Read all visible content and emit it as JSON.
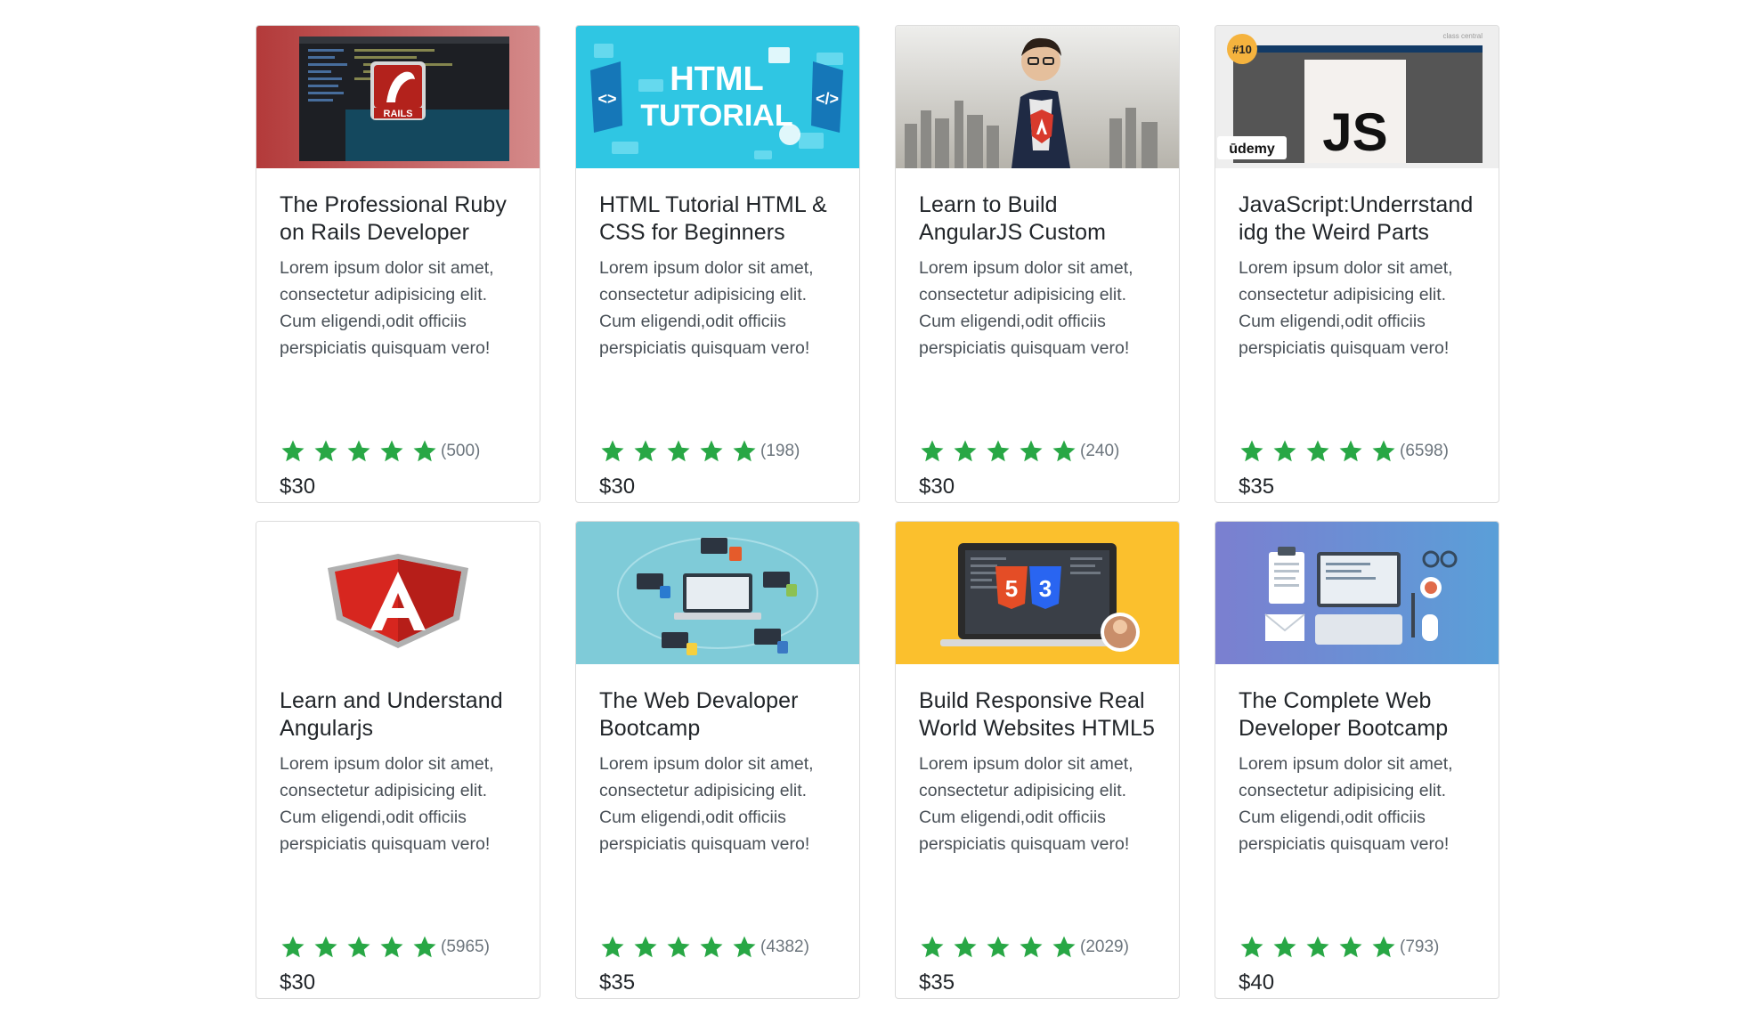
{
  "colors": {
    "star": "#28a745",
    "border": "#dcdcdc",
    "text": "#212529",
    "muted": "#6c757d"
  },
  "courses": [
    {
      "thumb": "rails",
      "thumb_text": [
        "RAILS"
      ],
      "title": "The Professional Ruby on Rails Developer",
      "description": "Lorem ipsum dolor sit amet, consectetur adipisicing elit. Cum eligendi,odit officiis perspiciatis quisquam vero!",
      "stars": 5,
      "count": "(500)",
      "price": "$30"
    },
    {
      "thumb": "html",
      "thumb_text": [
        "HTML",
        "TUTORIAL",
        "<>",
        "</>"
      ],
      "title": "HTML Tutorial HTML & CSS for Beginners",
      "description": "Lorem ipsum dolor sit amet, consectetur adipisicing elit. Cum eligendi,odit officiis perspiciatis quisquam vero!",
      "stars": 5,
      "count": "(198)",
      "price": "$30"
    },
    {
      "thumb": "angular-man",
      "thumb_text": [],
      "title": "Learn to Build AngularJS Custom",
      "description": "Lorem ipsum dolor sit amet, consectetur adipisicing elit. Cum eligendi,odit officiis perspiciatis quisquam vero!",
      "stars": 5,
      "count": "(240)",
      "price": "$30"
    },
    {
      "thumb": "js",
      "thumb_text": [
        "#10",
        "JS",
        "ūdemy",
        "class central"
      ],
      "title": "JavaScript:Underrstand idg the Weird Parts",
      "description": "Lorem ipsum dolor sit amet, consectetur adipisicing elit. Cum eligendi,odit officiis perspiciatis quisquam vero!",
      "stars": 5,
      "count": "(6598)",
      "price": "$35"
    },
    {
      "thumb": "angular-logo",
      "thumb_text": [],
      "title": "Learn and Understand Angularjs",
      "description": "Lorem ipsum dolor sit amet, consectetur adipisicing elit. Cum eligendi,odit officiis perspiciatis quisquam vero!",
      "stars": 5,
      "count": "(5965)",
      "price": "$30"
    },
    {
      "thumb": "webdev",
      "thumb_text": [],
      "title": "The Web Devaloper Bootcamp",
      "description": "Lorem ipsum dolor sit amet, consectetur adipisicing elit. Cum eligendi,odit officiis perspiciatis quisquam vero!",
      "stars": 5,
      "count": "(4382)",
      "price": "$35"
    },
    {
      "thumb": "html5-laptop",
      "thumb_text": [],
      "title": "Build Responsive Real World Websites HTML5",
      "description": "Lorem ipsum dolor sit amet, consectetur adipisicing elit. Cum eligendi,odit officiis perspiciatis quisquam vero!",
      "stars": 5,
      "count": "(2029)",
      "price": "$35"
    },
    {
      "thumb": "workspace",
      "thumb_text": [],
      "title": "The Complete Web Developer Bootcamp",
      "description": "Lorem ipsum dolor sit amet, consectetur adipisicing elit. Cum eligendi,odit officiis perspiciatis quisquam vero!",
      "stars": 5,
      "count": "(793)",
      "price": "$40"
    }
  ]
}
